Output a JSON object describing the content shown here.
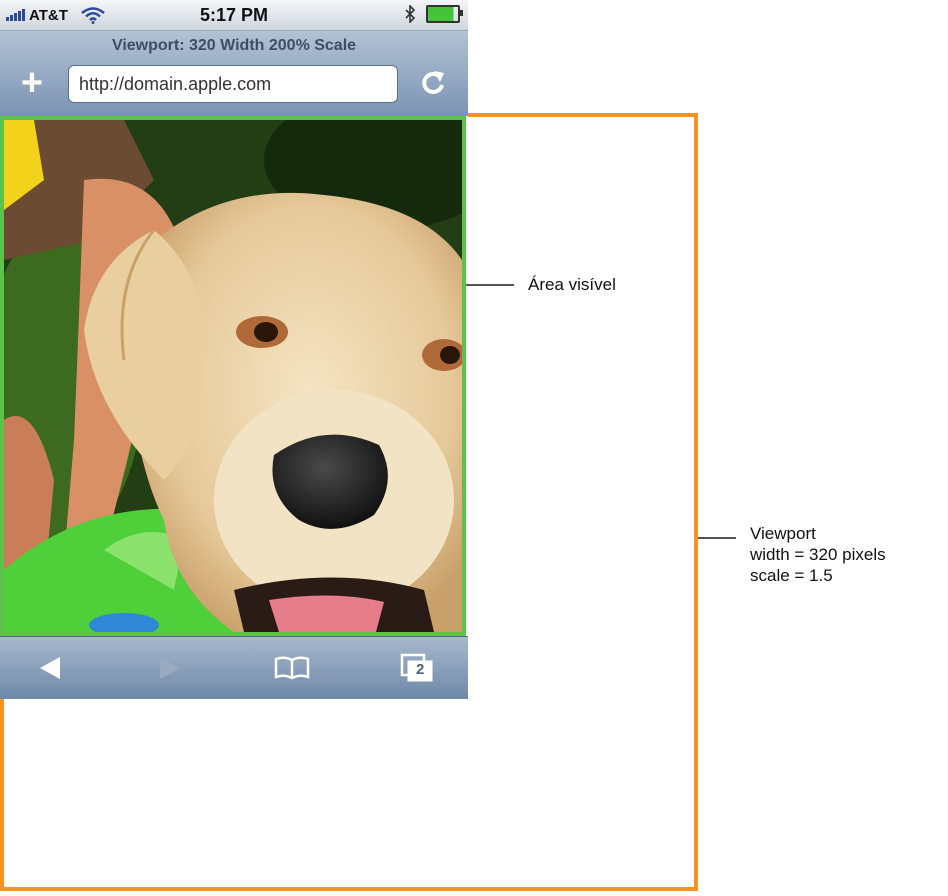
{
  "status_bar": {
    "carrier": "AT&T",
    "time": "5:17 PM"
  },
  "browser": {
    "page_title": "Viewport: 320 Width 200% Scale",
    "url": "http://domain.apple.com",
    "tabs_count": "2"
  },
  "annotations": {
    "visible_area": "Área visível",
    "viewport_title": "Viewport",
    "viewport_width": "width = 320 pixels",
    "viewport_scale": "scale = 1.5"
  },
  "colors": {
    "viewport_border": "#f7931e",
    "visible_area_border": "#5cc24a",
    "toolbar": "#7b93b2"
  },
  "icons": [
    "wifi-icon",
    "bluetooth-icon",
    "battery-icon",
    "add-bookmark-icon",
    "reload-icon",
    "back-icon",
    "forward-icon",
    "bookmarks-icon",
    "pages-icon"
  ]
}
